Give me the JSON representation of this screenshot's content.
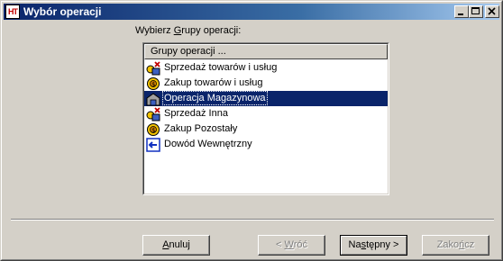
{
  "window": {
    "app_icon_text": "HT",
    "title": "Wybór operacji",
    "controls": {
      "minimize_icon": "minimize-icon",
      "maximize_icon": "maximize-icon",
      "close_icon": "close-icon"
    }
  },
  "prompt": {
    "before": "Wybierz ",
    "accel": "G",
    "after": "rupy operacji:"
  },
  "list": {
    "column_header": "Grupy operacji ...",
    "items": [
      {
        "label": "Sprzedaż towarów i usług",
        "icon": "sale-icon",
        "selected": false
      },
      {
        "label": "Zakup towarów i usług",
        "icon": "purchase-icon",
        "selected": false
      },
      {
        "label": "Operacja Magazynowa",
        "icon": "warehouse-icon",
        "selected": true
      },
      {
        "label": "Sprzedaż Inna",
        "icon": "sale-icon",
        "selected": false
      },
      {
        "label": "Zakup Pozostały",
        "icon": "purchase-icon",
        "selected": false
      },
      {
        "label": "Dowód Wewnętrzny",
        "icon": "internal-document-icon",
        "selected": false
      }
    ]
  },
  "buttons": {
    "cancel": {
      "accel": "A",
      "rest": "nuluj"
    },
    "back": {
      "prefix": "< ",
      "accel": "W",
      "rest": "róć",
      "disabled": true
    },
    "next": {
      "before": "Na",
      "accel": "s",
      "rest": "tępny >",
      "default": true
    },
    "finish": {
      "before": "Zako",
      "accel": "ń",
      "rest": "cz",
      "disabled": true
    }
  }
}
